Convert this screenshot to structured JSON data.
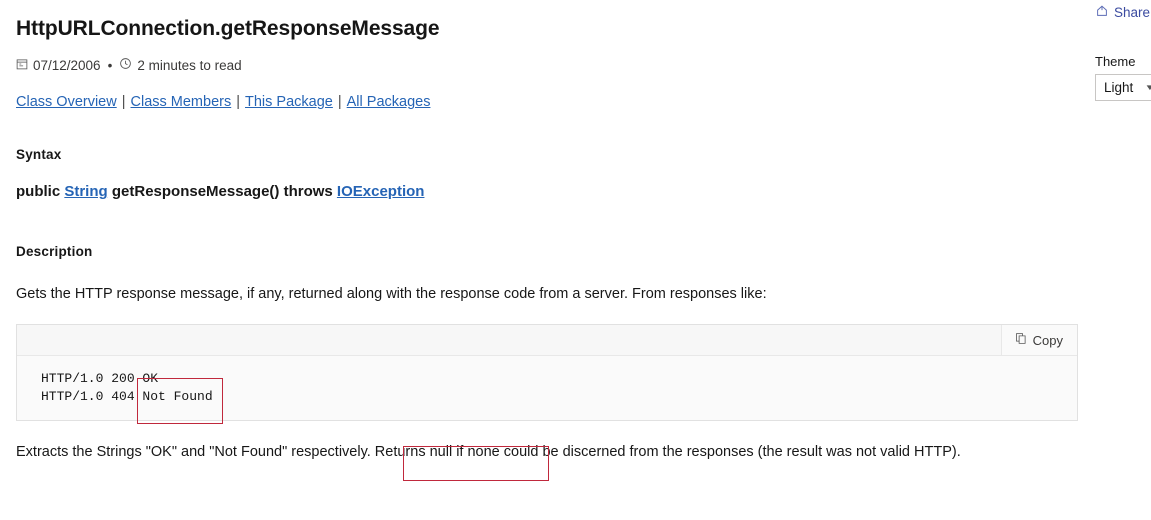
{
  "header": {
    "share_label": "Share",
    "share_icon": "share-icon",
    "theme_label": "Theme",
    "theme_value": "Light",
    "theme_options": [
      "Light"
    ],
    "chevron_icon": "chevron-down-icon"
  },
  "article": {
    "title": "HttpURLConnection.getResponseMessage",
    "meta": {
      "calendar_icon": "calendar-icon",
      "date": "07/12/2006",
      "separator": "•",
      "clock_icon": "clock-icon",
      "read_time": "2 minutes to read"
    },
    "nav_links": [
      {
        "label": "Class Overview"
      },
      {
        "label": "Class Members"
      },
      {
        "label": "This Package"
      },
      {
        "label": "All Packages"
      }
    ],
    "nav_separator": "|",
    "syntax": {
      "heading": "Syntax",
      "modifier": "public",
      "return_type_link": "String",
      "method": "getResponseMessage() throws",
      "throws_link": "IOException"
    },
    "description": {
      "heading": "Description",
      "intro": "Gets the HTTP response message, if any, returned along with the response code from a server. From responses like:",
      "code": "HTTP/1.0 200 OK\nHTTP/1.0 404 Not Found",
      "copy_label": "Copy",
      "copy_icon": "copy-icon",
      "closing": "Extracts the Strings \"OK\" and \"Not Found\" respectively. Returns null if none could be discerned from the responses (the result was not valid HTTP)."
    }
  },
  "annotations": [
    {
      "name": "code-status-message-highlight",
      "color": "#c0283c"
    },
    {
      "name": "returns-null-if-none-highlight",
      "color": "#c0283c"
    }
  ]
}
